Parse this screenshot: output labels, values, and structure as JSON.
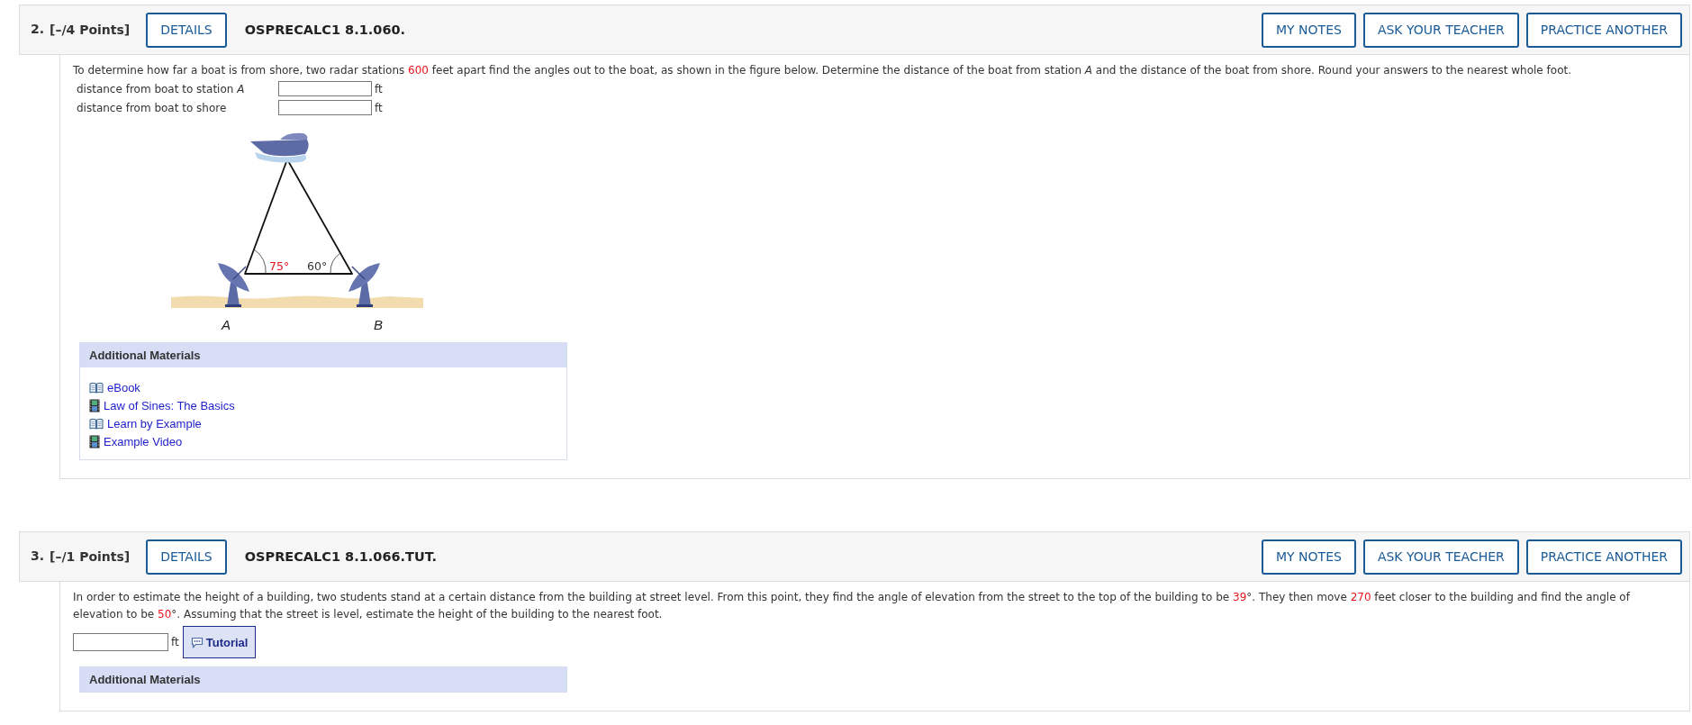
{
  "questions": [
    {
      "number": "2.",
      "points": "[–/4 Points]",
      "details": "DETAILS",
      "code": "OSPRECALC1 8.1.060.",
      "header_buttons": [
        "MY NOTES",
        "ASK YOUR TEACHER",
        "PRACTICE ANOTHER"
      ],
      "prompt": [
        {
          "kind": "text",
          "text": "To determine how far a boat is from shore, two radar stations "
        },
        {
          "kind": "value",
          "text": "600"
        },
        {
          "kind": "text",
          "text": " feet apart find the angles out to the boat, as shown in the figure below. Determine the distance of the boat from station "
        },
        {
          "kind": "var",
          "text": "A"
        },
        {
          "kind": "text",
          "text": " and the distance of the boat from shore. Round your answers to the nearest whole foot."
        }
      ],
      "answers": [
        {
          "label": [
            {
              "kind": "text",
              "text": "distance from boat to station "
            },
            {
              "kind": "var",
              "text": "A"
            }
          ],
          "unit": "ft"
        },
        {
          "label": [
            {
              "kind": "text",
              "text": "distance from boat to shore"
            }
          ],
          "unit": "ft"
        }
      ],
      "figure": {
        "angle_a": "75°",
        "angle_b": "60°",
        "label_a": "A",
        "label_b": "B"
      },
      "materials": {
        "title": "Additional Materials",
        "items": [
          {
            "kind": "book",
            "label": "eBook"
          },
          {
            "kind": "video",
            "label": "Law of Sines: The Basics"
          },
          {
            "kind": "book",
            "label": "Learn by Example"
          },
          {
            "kind": "video",
            "label": "Example Video"
          }
        ]
      }
    },
    {
      "number": "3.",
      "points": "[–/1 Points]",
      "details": "DETAILS",
      "code": "OSPRECALC1 8.1.066.TUT.",
      "header_buttons": [
        "MY NOTES",
        "ASK YOUR TEACHER",
        "PRACTICE ANOTHER"
      ],
      "prompt": [
        {
          "kind": "text",
          "text": "In order to estimate the height of a building, two students stand at a certain distance from the building at street level. From this point, they find the angle of elevation from the street to the top of the building to be "
        },
        {
          "kind": "value",
          "text": "39"
        },
        {
          "kind": "text",
          "text": "°. They then move "
        },
        {
          "kind": "value",
          "text": "270"
        },
        {
          "kind": "text",
          "text": " feet closer to the building and find the angle of elevation to be "
        },
        {
          "kind": "value",
          "text": "50"
        },
        {
          "kind": "text",
          "text": "°. Assuming that the street is level, estimate the height of the building to the nearest foot."
        }
      ],
      "inline_answer": {
        "unit": "ft",
        "tutorial": "Tutorial"
      },
      "materials": {
        "title": "Additional Materials"
      }
    }
  ]
}
